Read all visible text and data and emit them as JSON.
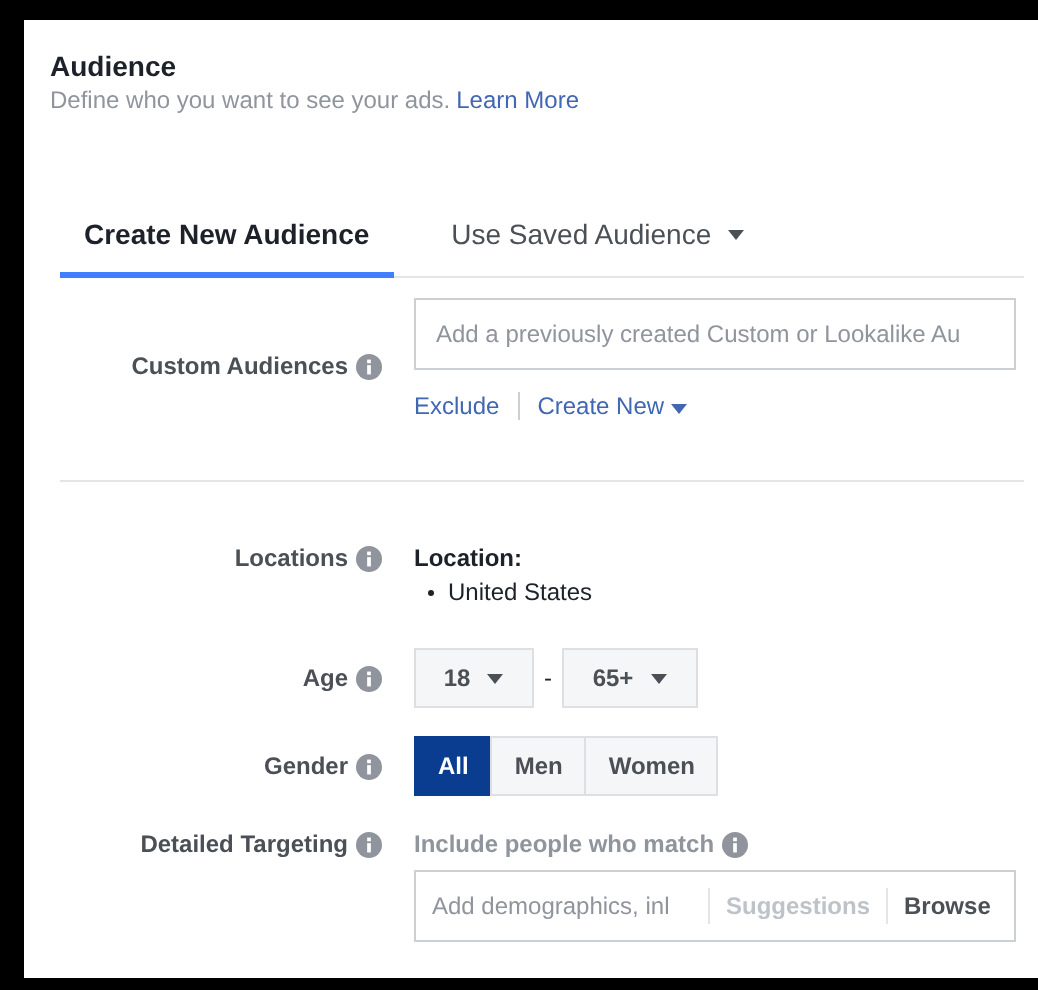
{
  "header": {
    "title": "Audience",
    "description": "Define who you want to see your ads.",
    "link": "Learn More"
  },
  "tabs": [
    {
      "label": "Create New Audience",
      "selected": true,
      "dropdown": false
    },
    {
      "label": "Use Saved Audience",
      "selected": false,
      "dropdown": true
    }
  ],
  "custom_audiences": {
    "label": "Custom Audiences",
    "placeholder": "Add a previously created Custom or Lookalike Au",
    "links": [
      {
        "label": "Exclude",
        "dropdown": false
      },
      {
        "label": "Create New",
        "dropdown": true
      }
    ]
  },
  "locations": {
    "label": "Locations",
    "heading": "Location:",
    "items": [
      "United States"
    ]
  },
  "age": {
    "label": "Age",
    "min": "18",
    "separator": "-",
    "max": "65+"
  },
  "gender": {
    "label": "Gender",
    "options": [
      {
        "label": "All",
        "selected": true
      },
      {
        "label": "Men",
        "selected": false
      },
      {
        "label": "Women",
        "selected": false
      }
    ]
  },
  "detailed_targeting": {
    "label": "Detailed Targeting",
    "heading": "Include people who match",
    "placeholder": "Add demographics, inl",
    "actions": [
      {
        "label": "Suggestions",
        "disabled": true
      },
      {
        "label": "Browse",
        "disabled": false
      }
    ]
  }
}
